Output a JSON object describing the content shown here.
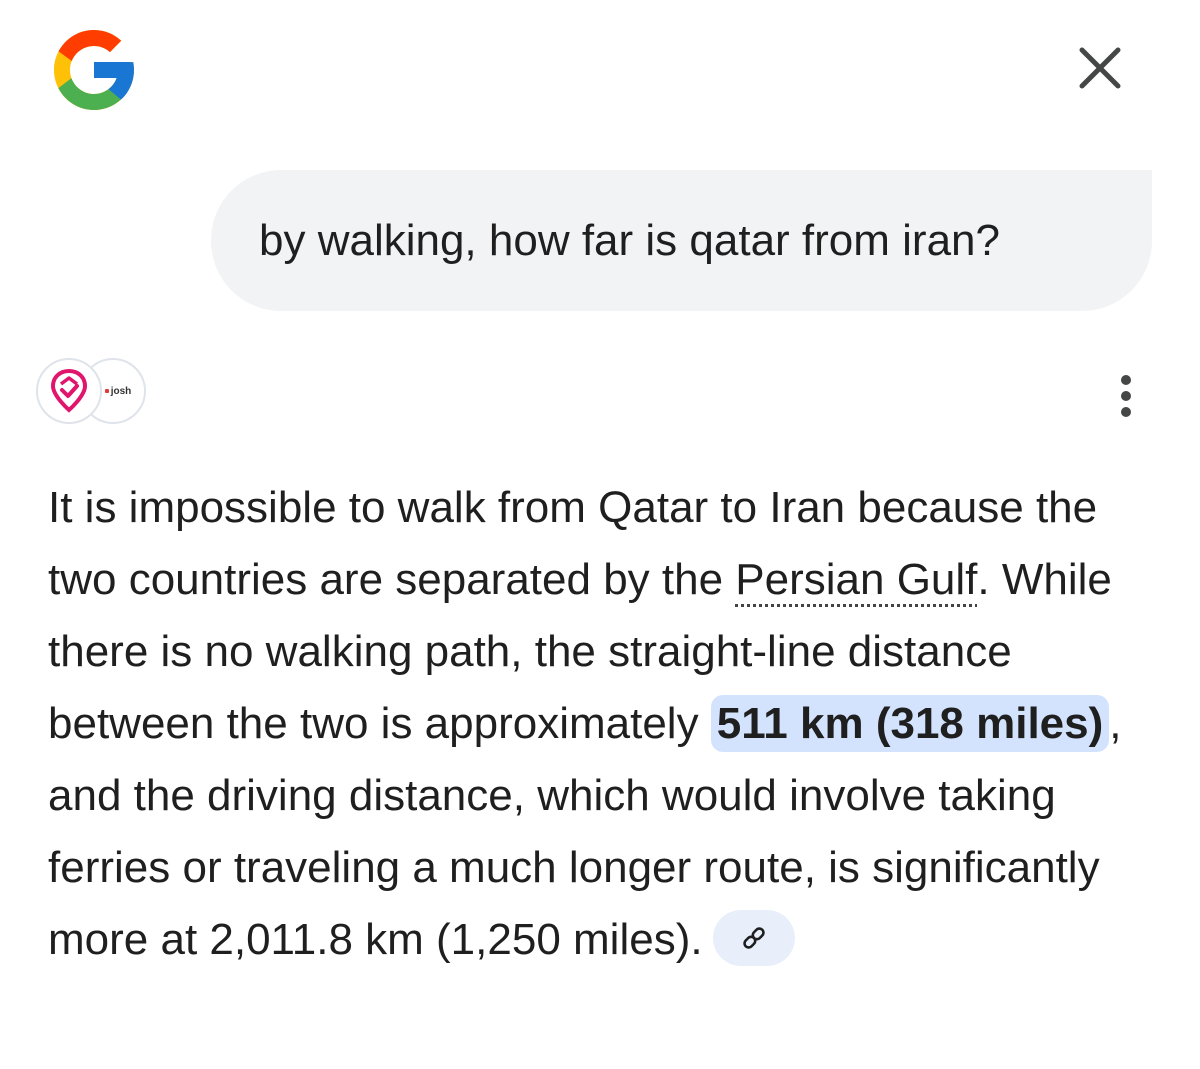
{
  "header": {
    "logo_icon": "google-g-logo",
    "close_icon": "close-icon"
  },
  "query": {
    "text": "by walking, how far is qatar from iran?"
  },
  "sources": [
    {
      "icon": "jagran-josh-pin-logo"
    },
    {
      "label": "josh"
    }
  ],
  "menu": {
    "icon": "more-vert-icon"
  },
  "answer": {
    "part1": "It is impossible to walk from Qatar to Iran because the two countries are separated by the ",
    "link1": "Persian Gulf",
    "part2": ". While there is no walking path, the straight-line distance between the two is approximately ",
    "highlight": "511 km (318 miles)",
    "part3": ", and the driving distance, which would involve taking ferries or traveling a much longer route, is significantly more at 2,011.8 km (1,250 miles).",
    "citation_icon": "link-icon"
  },
  "colors": {
    "highlight_bg": "#d3e3fd",
    "bubble_bg": "#f1f3f4",
    "chip_bg": "#e8effa",
    "source_pink": "#e0156c"
  }
}
